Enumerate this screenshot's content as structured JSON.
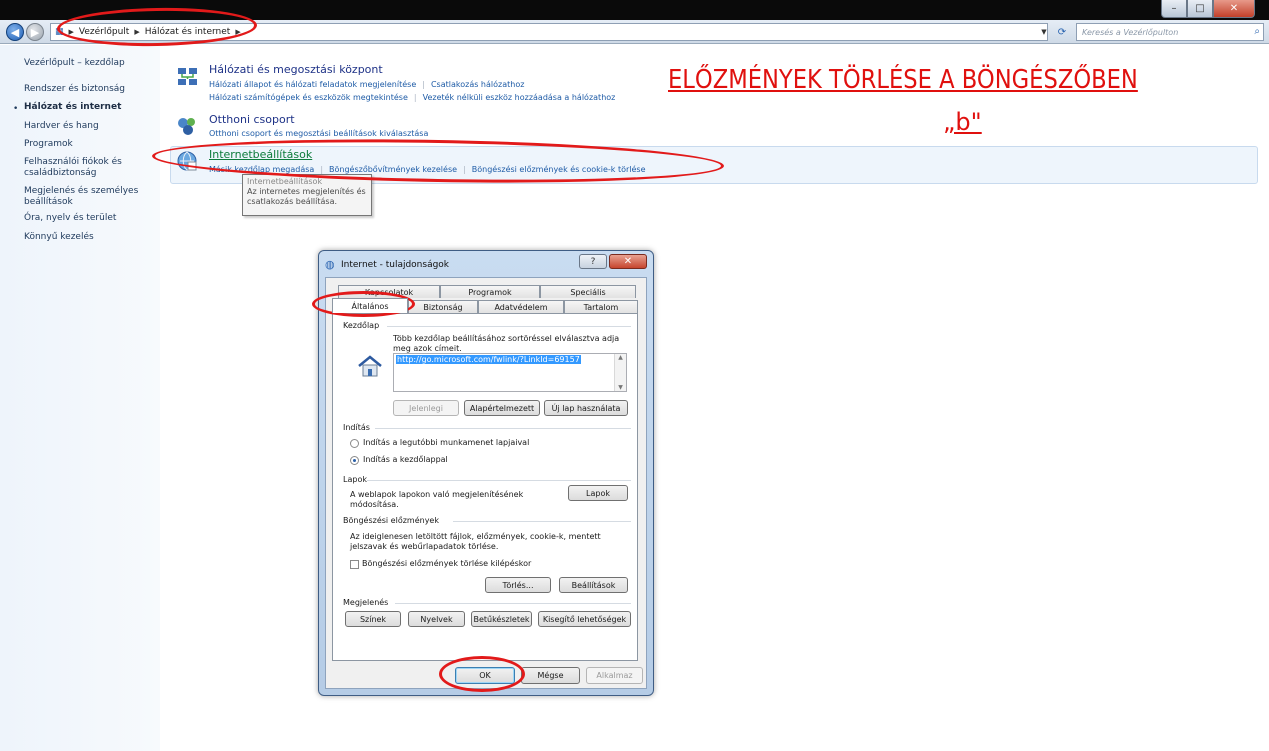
{
  "window": {
    "minimize": "–",
    "maximize": "□",
    "close": "✕"
  },
  "address": {
    "crumbs": [
      "Vezérlőpult",
      "Hálózat és internet"
    ],
    "search_placeholder": "Keresés a Vezérlőpulton"
  },
  "nav": {
    "items": [
      "Vezérlőpult – kezdőlap",
      "Rendszer és biztonság",
      "Hálózat és internet",
      "Hardver és hang",
      "Programok",
      "Felhasználói fiókok és családbiztonság",
      "Megjelenés és személyes beállítások",
      "Óra, nyelv és terület",
      "Könnyű kezelés"
    ]
  },
  "categories": {
    "network": {
      "title": "Hálózati és megosztási központ",
      "links1": [
        "Hálózati állapot és hálózati feladatok megjelenítése",
        "Csatlakozás hálózathoz"
      ],
      "links2": [
        "Hálózati számítógépek és eszközök megtekintése",
        "Vezeték nélküli eszköz hozzáadása a hálózathoz"
      ]
    },
    "homegroup": {
      "title": "Otthoni csoport",
      "links1": [
        "Otthoni csoport és megosztási beállítások kiválasztása"
      ]
    },
    "internet": {
      "title": "Internetbeállítások",
      "links1": [
        "Másik kezdőlap megadása",
        "Böngészőbővítmények kezelése",
        "Böngészési előzmények és cookie-k törlése"
      ]
    }
  },
  "tooltip": {
    "title": "Internetbeállítások",
    "line1": "Az internetes megjelenítés és",
    "line2": "csatlakozás beállítása."
  },
  "annotation": {
    "title": "ELŐZMÉNYEK TÖRLÉSE A BÖNGÉSZŐBEN",
    "subtitle": "„b\""
  },
  "dialog": {
    "title": "Internet - tulajdonságok",
    "help": "?",
    "close": "✕",
    "tabs_row1": [
      "Kapcsolatok",
      "Programok",
      "Speciális"
    ],
    "tabs_row2": [
      "Általános",
      "Biztonság",
      "Adatvédelem",
      "Tartalom"
    ],
    "home": {
      "group": "Kezdőlap",
      "desc": "Több kezdőlap beállításához sortöréssel elválasztva adja meg azok címeit.",
      "url": "http://go.microsoft.com/fwlink/?LinkId=69157",
      "btn_current": "Jelenlegi",
      "btn_default": "Alapértelmezett",
      "btn_new": "Új lap használata"
    },
    "startup": {
      "group": "Indítás",
      "opt1": "Indítás a legutóbbi munkamenet lapjaival",
      "opt2": "Indítás a kezdőlappal"
    },
    "tabs_group": {
      "group": "Lapok",
      "desc": "A weblapok lapokon való megjelenítésének módosítása.",
      "btn": "Lapok"
    },
    "history": {
      "group": "Böngészési előzmények",
      "desc": "Az ideiglenesen letöltött fájlok, előzmények, cookie-k, mentett jelszavak és webűrlapadatok törlése.",
      "checkbox": "Böngészési előzmények törlése kilépéskor",
      "btn_delete": "Törlés...",
      "btn_settings": "Beállítások"
    },
    "appearance": {
      "group": "Megjelenés",
      "btn_colors": "Színek",
      "btn_languages": "Nyelvek",
      "btn_fonts": "Betűkészletek",
      "btn_access": "Kisegítő lehetőségek"
    },
    "ok": "OK",
    "cancel": "Mégse",
    "apply": "Alkalmaz"
  }
}
